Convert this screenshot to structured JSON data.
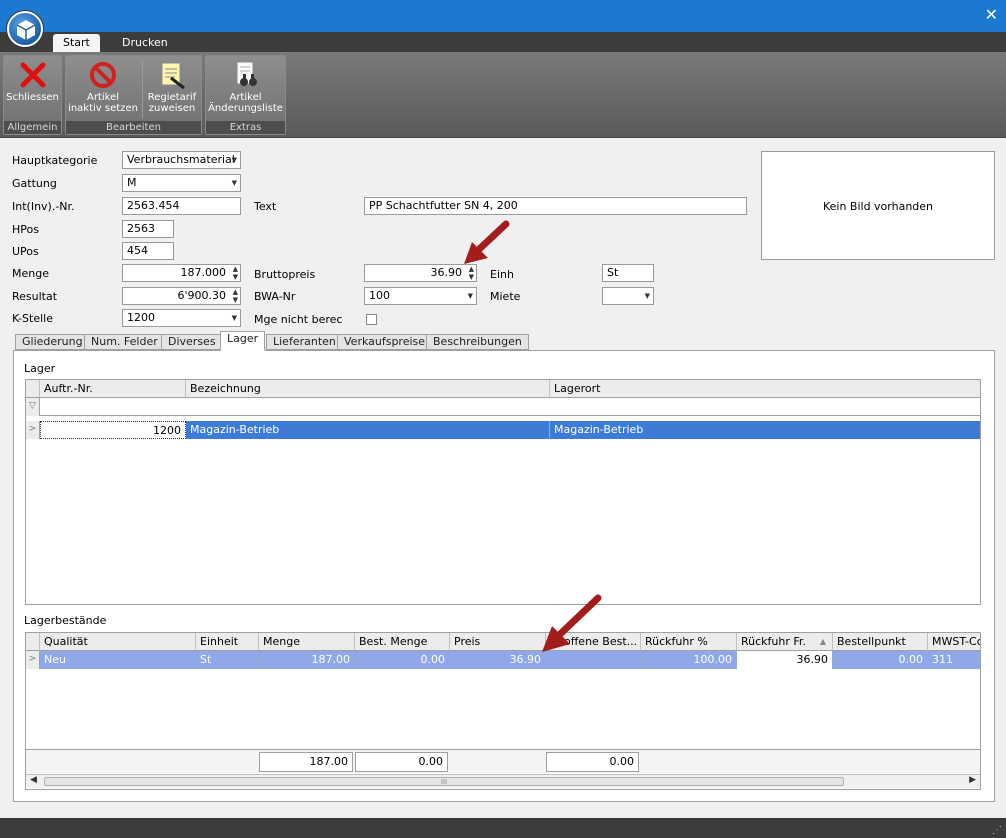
{
  "window": {
    "close_glyph": "✕"
  },
  "ribbon_tabs": [
    "Start",
    "Drucken"
  ],
  "ribbon": {
    "groups": [
      {
        "caption": "Allgemein",
        "buttons": [
          {
            "label": "Schliessen",
            "icon": "close-x-icon"
          }
        ]
      },
      {
        "caption": "Bearbeiten",
        "buttons": [
          {
            "label1": "Artikel",
            "label2": "inaktiv setzen",
            "icon": "no-entry-icon"
          },
          {
            "label1": "Regietarif",
            "label2": "zuweisen",
            "icon": "notepad-pencil-icon"
          }
        ]
      },
      {
        "caption": "Extras",
        "buttons": [
          {
            "label1": "Artikel",
            "label2": "Änderungsliste",
            "icon": "document-binoculars-icon"
          }
        ]
      }
    ]
  },
  "form": {
    "hauptkategorie": {
      "label": "Hauptkategorie",
      "value": "Verbrauchsmaterial"
    },
    "gattung": {
      "label": "Gattung",
      "value": "M"
    },
    "intnr": {
      "label": "Int(Inv).-Nr.",
      "value": "2563.454"
    },
    "text": {
      "label": "Text",
      "value": "PP Schachtfutter SN 4, 200"
    },
    "hpos": {
      "label": "HPos",
      "value": "2563"
    },
    "upos": {
      "label": "UPos",
      "value": "454"
    },
    "menge": {
      "label": "Menge",
      "value": "187.000"
    },
    "bruttopreis": {
      "label": "Bruttopreis",
      "value": "36.90"
    },
    "einh": {
      "label": "Einh",
      "value": "St"
    },
    "resultat": {
      "label": "Resultat",
      "value": "6'900.30"
    },
    "bwa": {
      "label": "BWA-Nr",
      "value": "100"
    },
    "miete": {
      "label": "Miete",
      "value": ""
    },
    "kstelle": {
      "label": "K-Stelle",
      "value": "1200"
    },
    "mge": {
      "label": "Mge nicht berec"
    },
    "picture": "Kein Bild vorhanden"
  },
  "detail_tabs": [
    "Gliederung",
    "Num. Felder",
    "Diverses",
    "Lager",
    "Lieferanten",
    "Verkaufspreise",
    "Beschreibungen"
  ],
  "lager": {
    "title": "Lager",
    "columns": [
      "Auftr.-Nr.",
      "Bezeichnung",
      "Lagerort"
    ],
    "row": {
      "auftr": "1200",
      "bezeichnung": "Magazin-Betrieb",
      "lagerort": "Magazin-Betrieb"
    }
  },
  "bestaende": {
    "title": "Lagerbestände",
    "columns": [
      "Qualität",
      "Einheit",
      "Menge",
      "Best. Menge",
      "Preis",
      "... offene Best...",
      "Rückfuhr %",
      "Rückfuhr Fr.",
      "Bestellpunkt",
      "MWST-Co"
    ],
    "row": [
      "Neu",
      "St",
      "187.00",
      "0.00",
      "36.90",
      "",
      "100.00",
      "36.90",
      "0.00",
      "311"
    ],
    "totals": {
      "menge": "187.00",
      "best_menge": "0.00",
      "offene": "0.00"
    },
    "scroll_grip": "III"
  },
  "colors": {
    "accent": "#1b79d1",
    "selection": "#3d7bd6",
    "arrow": "#a31d1d"
  }
}
